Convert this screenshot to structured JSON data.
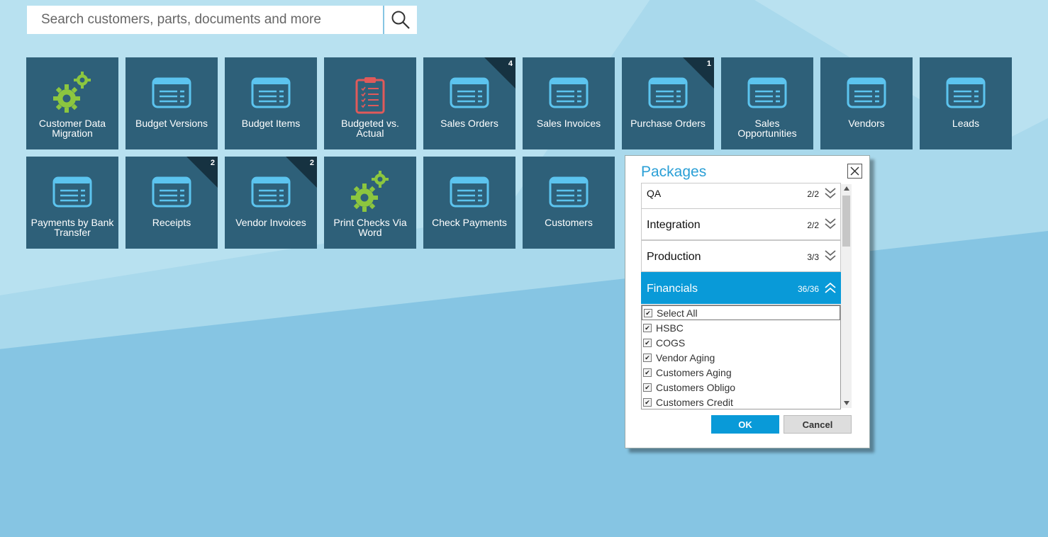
{
  "search": {
    "placeholder": "Search customers, parts, documents and more"
  },
  "tiles_row1": [
    {
      "label": "Customer Data Migration",
      "icon": "gears-icon",
      "badge": ""
    },
    {
      "label": "Budget Versions",
      "icon": "screen-list-icon",
      "badge": ""
    },
    {
      "label": "Budget Items",
      "icon": "screen-list-icon",
      "badge": ""
    },
    {
      "label": "Budgeted vs. Actual",
      "icon": "clipboard-icon",
      "badge": ""
    },
    {
      "label": "Sales Orders",
      "icon": "screen-list-icon",
      "badge": "4"
    },
    {
      "label": "Sales Invoices",
      "icon": "screen-list-icon",
      "badge": ""
    },
    {
      "label": "Purchase Orders",
      "icon": "screen-list-icon",
      "badge": "1"
    },
    {
      "label": "Sales Opportunities",
      "icon": "screen-list-icon",
      "badge": ""
    },
    {
      "label": "Vendors",
      "icon": "screen-list-icon",
      "badge": ""
    },
    {
      "label": "Leads",
      "icon": "screen-list-icon",
      "badge": ""
    }
  ],
  "tiles_row2": [
    {
      "label": "Payments by Bank Transfer",
      "icon": "screen-list-icon",
      "badge": ""
    },
    {
      "label": "Receipts",
      "icon": "screen-list-icon",
      "badge": "2"
    },
    {
      "label": "Vendor Invoices",
      "icon": "screen-list-icon",
      "badge": "2"
    },
    {
      "label": "Print Checks Via Word",
      "icon": "gears-icon",
      "badge": ""
    },
    {
      "label": "Check Payments",
      "icon": "screen-list-icon",
      "badge": ""
    },
    {
      "label": "Customers",
      "icon": "screen-list-icon",
      "badge": ""
    }
  ],
  "dialog": {
    "title": "Packages",
    "sections": [
      {
        "name": "QA",
        "count": "2/2",
        "expanded": false
      },
      {
        "name": "Integration",
        "count": "2/2",
        "expanded": false
      },
      {
        "name": "Production",
        "count": "3/3",
        "expanded": false
      },
      {
        "name": "Financials",
        "count": "36/36",
        "expanded": true
      }
    ],
    "items": [
      "Select All",
      "HSBC",
      "COGS",
      "Vendor Aging",
      "Customers Aging",
      "Customers Obligo",
      "Customers Credit"
    ],
    "ok_label": "OK",
    "cancel_label": "Cancel"
  },
  "colors": {
    "tile": "#2e6079",
    "accent": "#099ad8",
    "gear": "#8cc63f",
    "clipboard": "#e05a5a"
  }
}
